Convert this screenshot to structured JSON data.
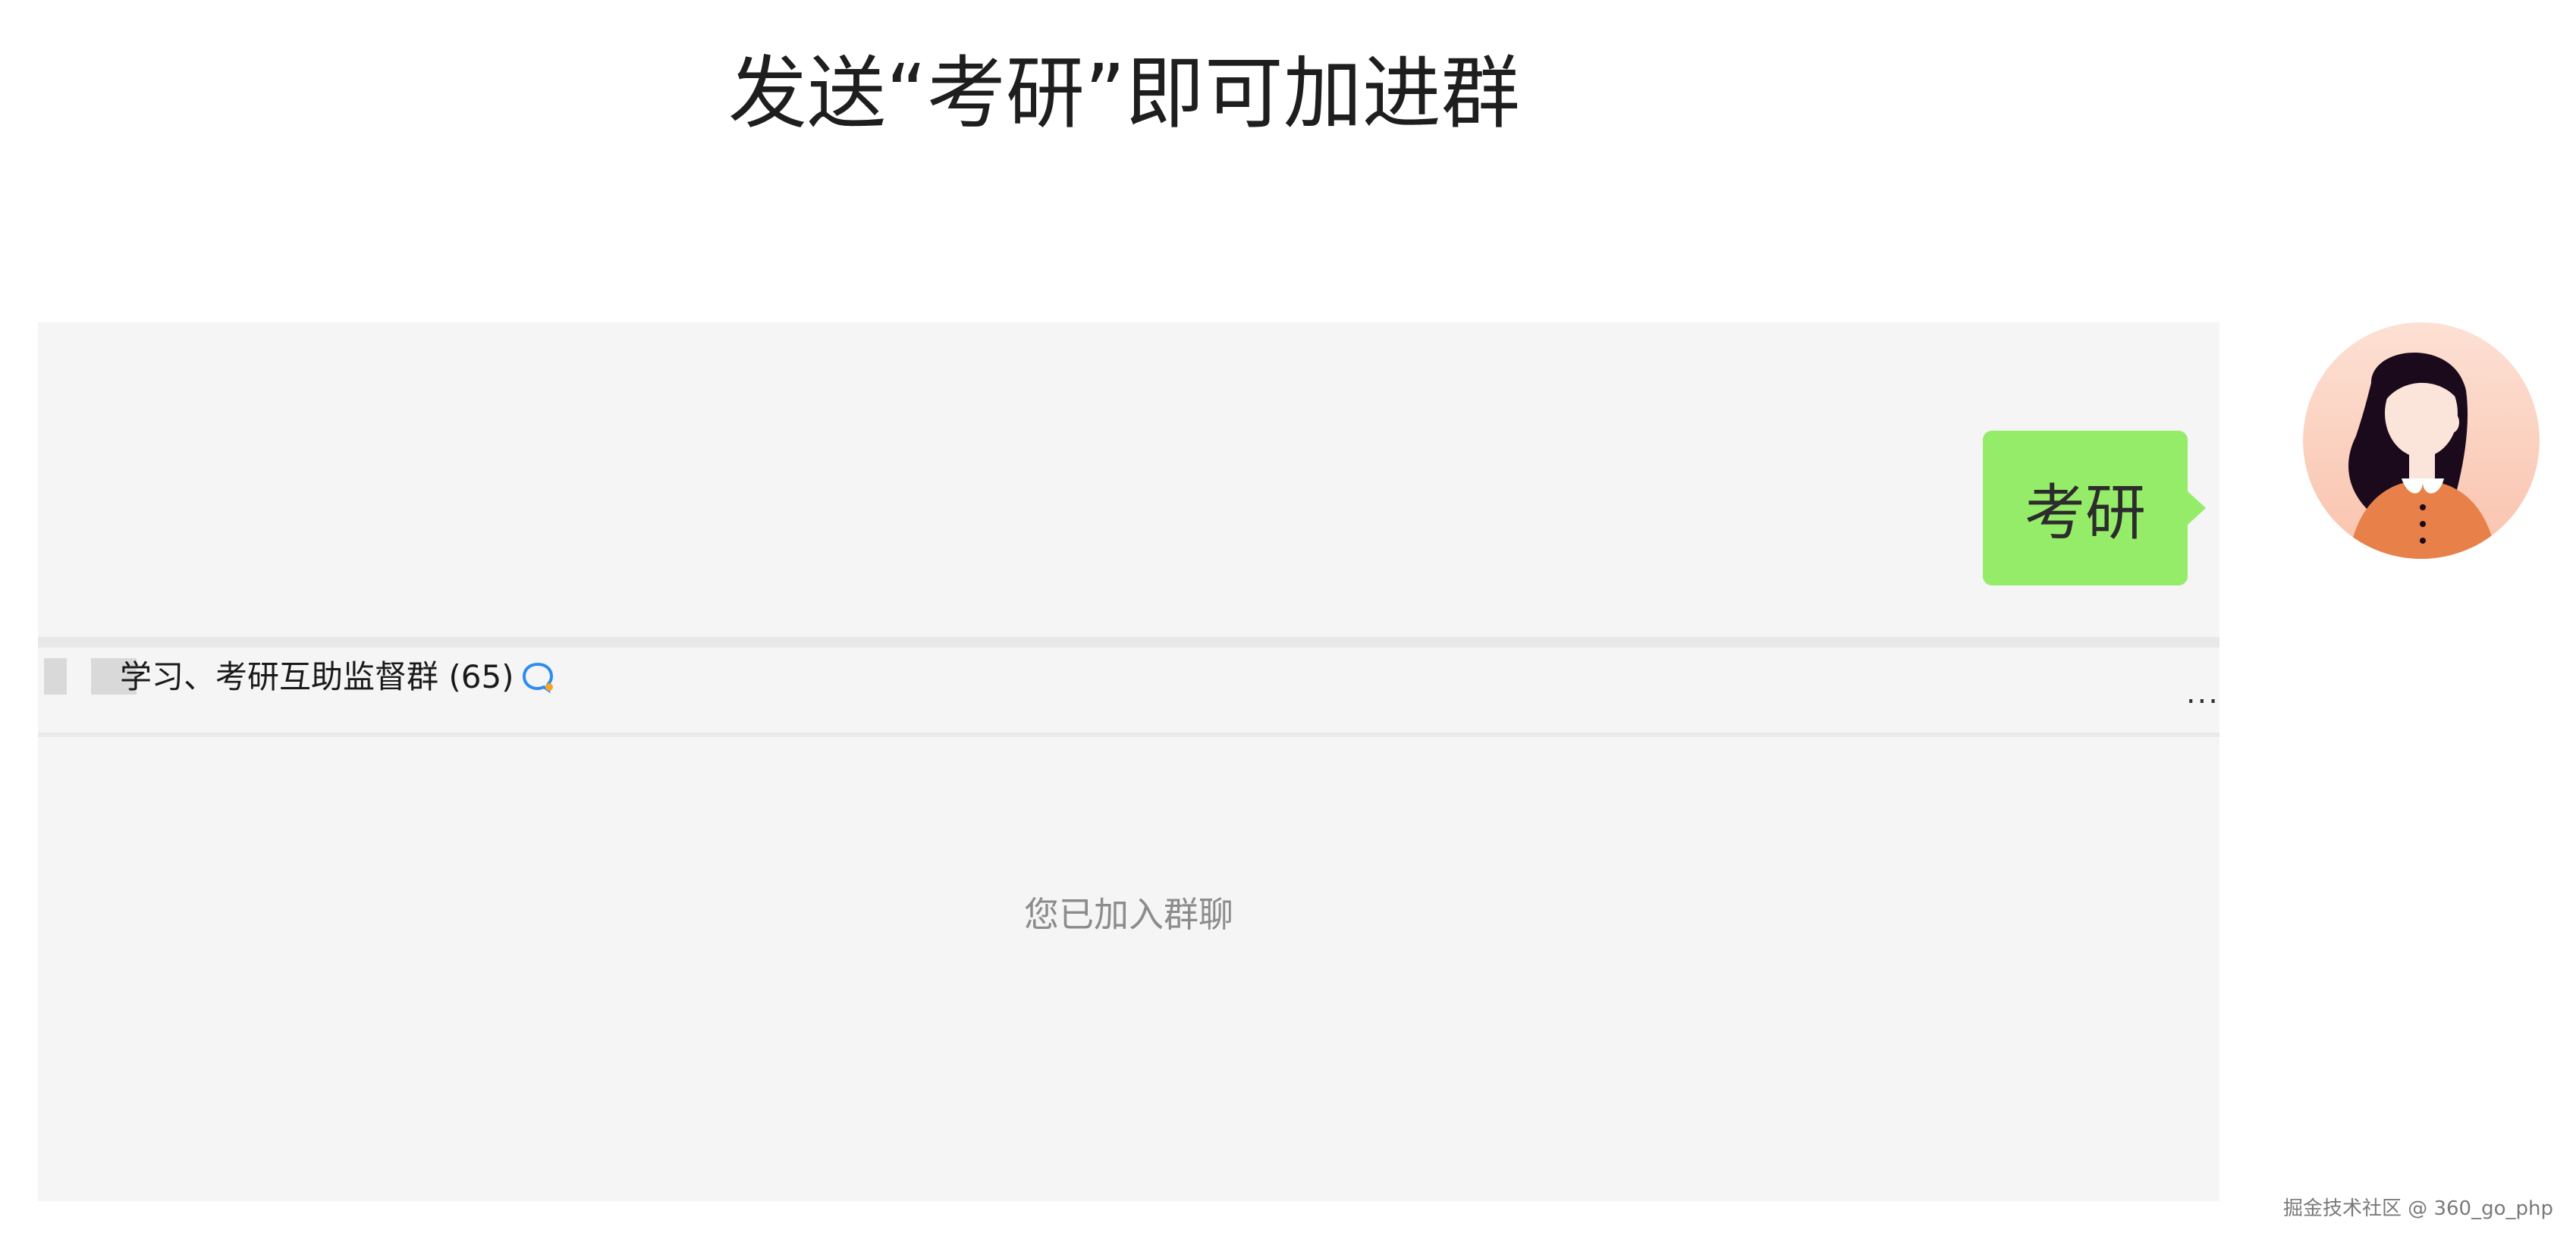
{
  "headline": "发送“考研”即可加进群",
  "message": {
    "text": "考研",
    "bubble_color": "#95ec69"
  },
  "group": {
    "name": "学习、考研互助监督群 (65)",
    "more_label": "..."
  },
  "system_notice": "您已加入群聊",
  "watermark": "掘金技术社区 @ 360_go_php",
  "colors": {
    "panel_bg": "#f5f5f5",
    "notice_text": "#8c8c8c",
    "avatar_bg": "#fcd0c0",
    "shirt": "#e8804a",
    "hair": "#1b0a1c"
  },
  "icons": {
    "chat": "chat-bubble-icon",
    "more": "more-icon",
    "avatar": "avatar"
  }
}
